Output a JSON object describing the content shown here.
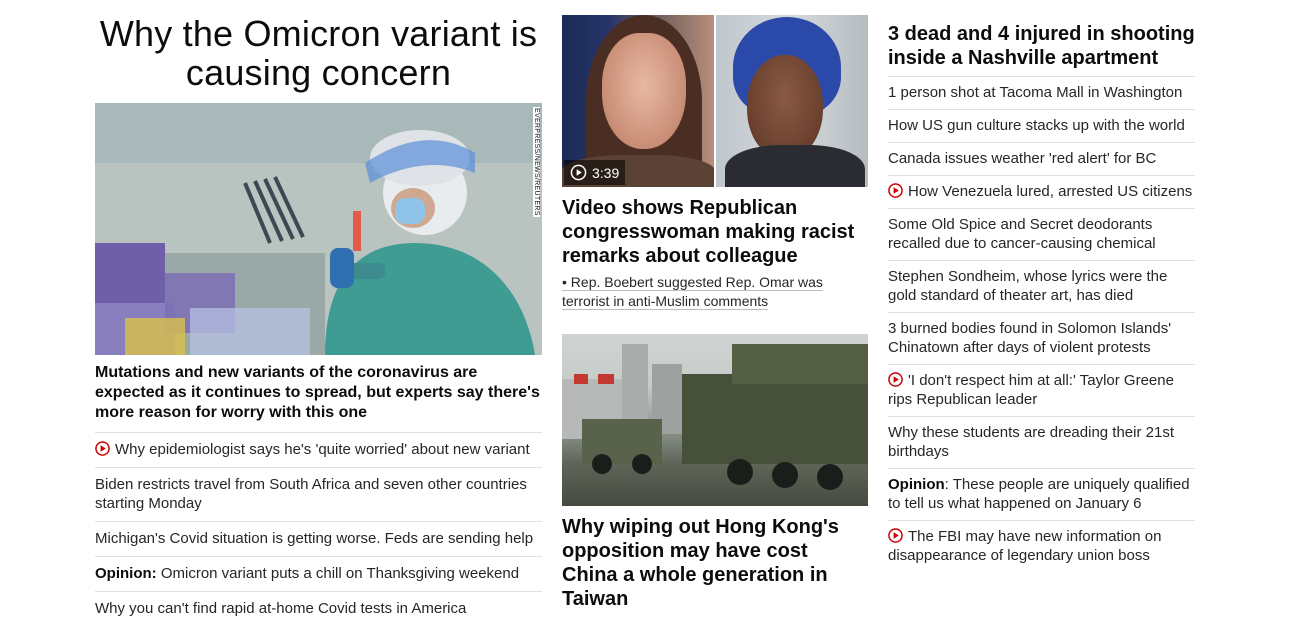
{
  "col1": {
    "headline": "Why the Omicron variant is causing concern",
    "image_credit": "EVERPRESS/NEWS/REUTERS",
    "summary": "Mutations and new variants of the coronavirus are expected as it continues to spread, but experts say there's more reason for worry with this one",
    "items": [
      {
        "video": true,
        "prefix": "",
        "text": "Why epidemiologist says he's 'quite worried' about new variant"
      },
      {
        "video": false,
        "prefix": "",
        "text": "Biden restricts travel from South Africa and seven other countries starting Monday"
      },
      {
        "video": false,
        "prefix": "",
        "text": "Michigan's Covid situation is getting worse. Feds are sending help"
      },
      {
        "video": false,
        "prefix": "Opinion:",
        "text": " Omicron variant puts a chill on Thanksgiving weekend"
      },
      {
        "video": false,
        "prefix": "",
        "text": "Why you can't find rapid at-home Covid tests in America"
      }
    ]
  },
  "col2": {
    "video_duration": "3:39",
    "video_headline": "Video shows Republican congresswoman making racist remarks about colleague",
    "video_bullet": "• Rep. Boebert suggested Rep. Omar was terrorist in anti-Muslim comments",
    "story_headline": "Why wiping out Hong Kong's opposition may have cost China a whole generation in Taiwan"
  },
  "col3": {
    "headline": "3 dead and 4 injured in shooting inside a Nashville apartment",
    "items": [
      {
        "video": false,
        "prefix": "",
        "text": "1 person shot at Tacoma Mall in Washington"
      },
      {
        "video": false,
        "prefix": "",
        "text": "How US gun culture stacks up with the world"
      },
      {
        "video": false,
        "prefix": "",
        "text": "Canada issues weather 'red alert' for BC"
      },
      {
        "video": true,
        "prefix": "",
        "text": "How Venezuela lured, arrested US citizens"
      },
      {
        "video": false,
        "prefix": "",
        "text": "Some Old Spice and Secret deodorants recalled due to cancer-causing chemical"
      },
      {
        "video": false,
        "prefix": "",
        "text": "Stephen Sondheim, whose lyrics were the gold standard of theater art, has died"
      },
      {
        "video": false,
        "prefix": "",
        "text": "3 burned bodies found in Solomon Islands' Chinatown after days of violent protests"
      },
      {
        "video": true,
        "prefix": "",
        "text": "'I don't respect him at all:' Taylor Greene rips Republican leader"
      },
      {
        "video": false,
        "prefix": "",
        "text": "Why these students are dreading their 21st birthdays"
      },
      {
        "video": false,
        "prefix": "Opinion",
        "text": ": These people are uniquely qualified to tell us what happened on January 6"
      },
      {
        "video": true,
        "prefix": "",
        "text": "The FBI may have new information on disappearance of legendary union boss"
      }
    ]
  },
  "colors": {
    "play_red": "#cc0000",
    "divider": "#e0e0e0"
  }
}
